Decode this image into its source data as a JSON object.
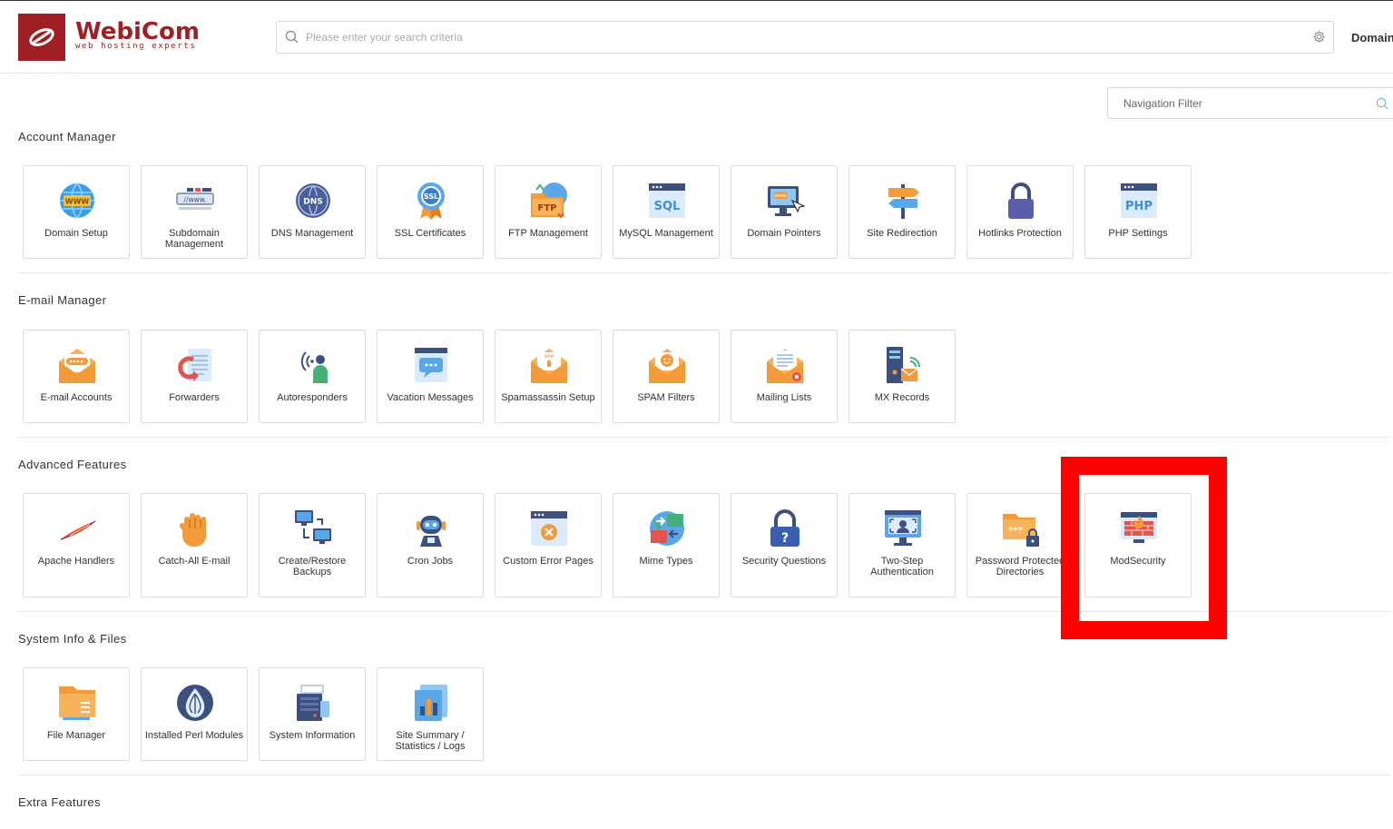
{
  "brand": {
    "name": "WebiCom",
    "tagline": "web hosting experts",
    "color": "#a01f24"
  },
  "header": {
    "search_placeholder": "Please enter your search criteria",
    "domain_label": "Domain"
  },
  "nav_filter": {
    "placeholder": "Navigation Filter"
  },
  "highlight_color": "#ff0000",
  "sections": [
    {
      "title": "Account Manager",
      "items": [
        {
          "label": "Domain Setup",
          "icon": "globe-www-icon"
        },
        {
          "label": "Subdomain Management",
          "icon": "subdomain-bar-icon"
        },
        {
          "label": "DNS Management",
          "icon": "dns-globe-icon"
        },
        {
          "label": "SSL Certificates",
          "icon": "ssl-badge-icon"
        },
        {
          "label": "FTP Management",
          "icon": "ftp-folder-icon"
        },
        {
          "label": "MySQL Management",
          "icon": "sql-window-icon"
        },
        {
          "label": "Domain Pointers",
          "icon": "domain-pointer-monitor-icon"
        },
        {
          "label": "Site Redirection",
          "icon": "signpost-icon"
        },
        {
          "label": "Hotlinks Protection",
          "icon": "padlock-icon"
        },
        {
          "label": "PHP Settings",
          "icon": "php-window-icon"
        }
      ]
    },
    {
      "title": "E-mail Manager",
      "items": [
        {
          "label": "E-mail Accounts",
          "icon": "envelope-dots-icon"
        },
        {
          "label": "Forwarders",
          "icon": "forward-document-icon"
        },
        {
          "label": "Autoresponders",
          "icon": "person-signal-icon"
        },
        {
          "label": "Vacation Messages",
          "icon": "chat-window-icon"
        },
        {
          "label": "Spamassassin Setup",
          "icon": "spam-envelope-icon"
        },
        {
          "label": "SPAM Filters",
          "icon": "smiley-envelope-icon"
        },
        {
          "label": "Mailing Lists",
          "icon": "list-envelope-icon"
        },
        {
          "label": "MX Records",
          "icon": "server-mail-icon"
        }
      ]
    },
    {
      "title": "Advanced Features",
      "items": [
        {
          "label": "Apache Handlers",
          "icon": "feather-icon"
        },
        {
          "label": "Catch-All E-mail",
          "icon": "hand-icon"
        },
        {
          "label": "Create/Restore Backups",
          "icon": "backup-computers-icon"
        },
        {
          "label": "Cron Jobs",
          "icon": "robot-icon"
        },
        {
          "label": "Custom Error Pages",
          "icon": "error-window-icon"
        },
        {
          "label": "Mime Types",
          "icon": "mime-globe-icon"
        },
        {
          "label": "Security Questions",
          "icon": "question-lock-icon"
        },
        {
          "label": "Two-Step Authentication",
          "icon": "two-step-monitor-icon"
        },
        {
          "label": "Password Protected Directories",
          "icon": "locked-folder-icon"
        },
        {
          "label": "ModSecurity",
          "icon": "firewall-icon"
        }
      ]
    },
    {
      "title": "System Info & Files",
      "items": [
        {
          "label": "File Manager",
          "icon": "folder-icon"
        },
        {
          "label": "Installed Perl Modules",
          "icon": "perl-onion-icon"
        },
        {
          "label": "System Information",
          "icon": "server-info-icon"
        },
        {
          "label": "Site Summary / Statistics / Logs",
          "icon": "statistics-icon"
        }
      ]
    },
    {
      "title": "Extra Features",
      "items": []
    }
  ]
}
